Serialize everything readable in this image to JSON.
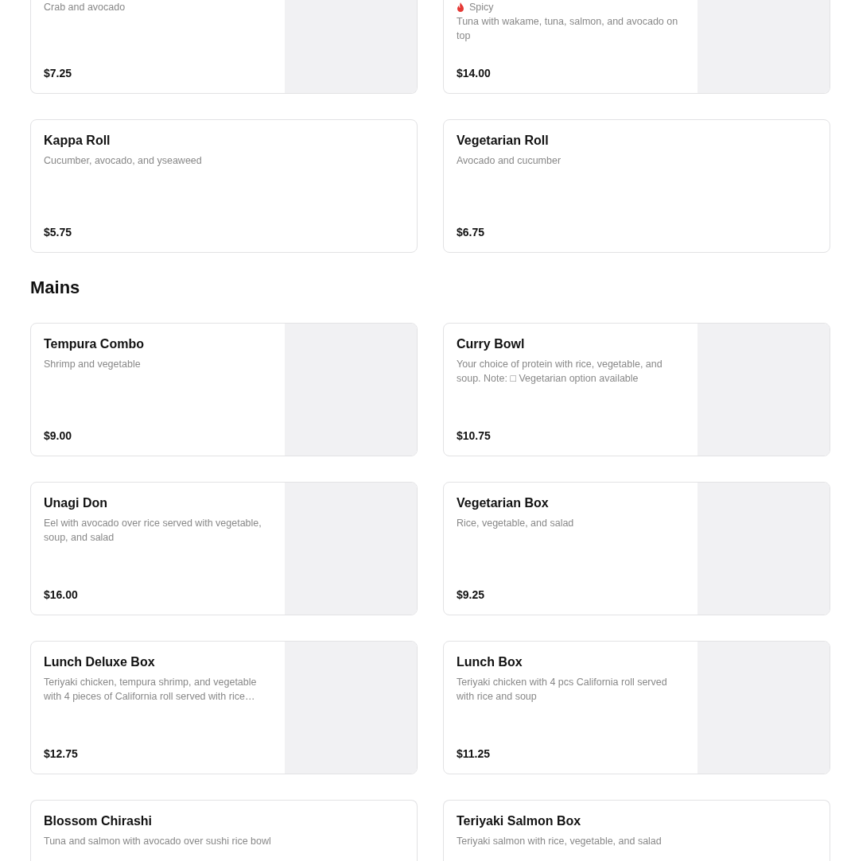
{
  "sections": [
    {
      "items": [
        {
          "kind": "cut-top",
          "description": "Crab and avocado",
          "price": "$7.25",
          "image": true
        },
        {
          "kind": "cut-top",
          "tag": {
            "kind": "spicy",
            "label": "Spicy"
          },
          "description": "Tuna with wakame, tuna, salmon, and avocado on top",
          "price": "$14.00",
          "image": true
        },
        {
          "kind": "full",
          "name": "Kappa Roll",
          "description": "Cucumber, avocado, and yseaweed",
          "price": "$5.75",
          "image": false
        },
        {
          "kind": "full",
          "name": "Vegetarian Roll",
          "description": "Avocado and cucumber",
          "price": "$6.75",
          "image": false
        }
      ]
    },
    {
      "heading": "Mains",
      "items": [
        {
          "kind": "full",
          "name": "Tempura Combo",
          "description": "Shrimp and vegetable",
          "price": "$9.00",
          "image": true
        },
        {
          "kind": "full",
          "name": "Curry Bowl",
          "description": "Your choice of protein with rice, vegetable, and soup. Note: □ Vegetarian option available",
          "price": "$10.75",
          "image": true
        },
        {
          "kind": "full",
          "name": "Unagi Don",
          "description": "Eel with avocado over rice served with vegetable, soup, and salad",
          "price": "$16.00",
          "image": true
        },
        {
          "kind": "full",
          "name": "Vegetarian Box",
          "description": "Rice, vegetable, and salad",
          "price": "$9.25",
          "image": true
        },
        {
          "kind": "full",
          "name": "Lunch Deluxe Box",
          "description": "Teriyaki chicken, tempura shrimp, and vegetable with 4 pieces of California roll served with rice…",
          "price": "$12.75",
          "image": true
        },
        {
          "kind": "full",
          "name": "Lunch Box",
          "description": "Teriyaki chicken with 4 pcs California roll served with rice and soup",
          "price": "$11.25",
          "image": true
        },
        {
          "kind": "cut-bottom",
          "name": "Blossom Chirashi",
          "description": "Tuna and salmon with avocado over sushi rice bowl",
          "image": false
        },
        {
          "kind": "cut-bottom",
          "name": "Teriyaki Salmon Box",
          "description": "Teriyaki salmon with rice, vegetable, and salad",
          "image": false
        }
      ]
    }
  ]
}
